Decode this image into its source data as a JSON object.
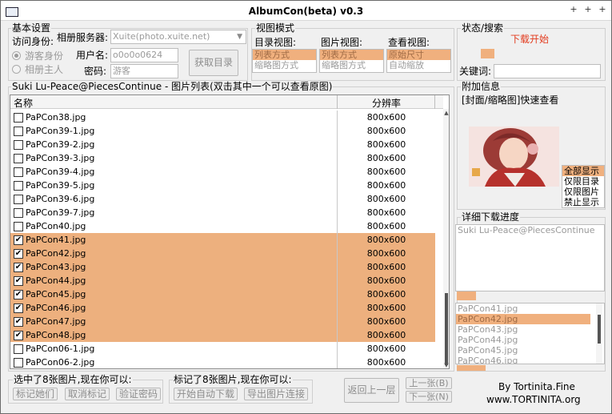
{
  "window": {
    "title": "AlbumCon(beta) v0.3",
    "controls": [
      "+",
      "+",
      "+"
    ]
  },
  "basic": {
    "group_title": "基本设置",
    "access_label": "访问身份:",
    "visitor": "游客身份",
    "owner": "相册主人",
    "server_label": "相册服务器:",
    "server_value": "Xuite(photo.xuite.net)",
    "user_label": "用户名:",
    "user_value": "o0o0o0624",
    "pass_label": "密码:",
    "pass_value": "游客",
    "fetch_button": "获取目录"
  },
  "view": {
    "group_title": "视图模式",
    "dir_view": "目录视图:",
    "pic_view": "图片视图:",
    "browse_view": "查看视图:",
    "dir_options": [
      "列表方式",
      "缩略图方式"
    ],
    "pic_options": [
      "列表方式",
      "缩略图方式"
    ],
    "browse_options": [
      "原始尺寸",
      "自动缩放"
    ],
    "dir_selected": 0,
    "pic_selected": 0,
    "browse_selected": 0
  },
  "status": {
    "group_title": "状态/搜索",
    "status_text": "下载开始",
    "keyword_label": "关键词:",
    "keyword_value": "",
    "progress": 0.14
  },
  "filelist": {
    "group_title": "Suki Lu-Peace@PiecesContinue - 图片列表(双击其中一个可以查看原图)",
    "col_name": "名称",
    "col_res": "分辨率",
    "rows": [
      {
        "name": "PaPCon38.jpg",
        "res": "800x600",
        "checked": false
      },
      {
        "name": "PaPCon39-1.jpg",
        "res": "800x600",
        "checked": false
      },
      {
        "name": "PaPCon39-2.jpg",
        "res": "800x600",
        "checked": false
      },
      {
        "name": "PaPCon39-3.jpg",
        "res": "800x600",
        "checked": false
      },
      {
        "name": "PaPCon39-4.jpg",
        "res": "800x600",
        "checked": false
      },
      {
        "name": "PaPCon39-5.jpg",
        "res": "800x600",
        "checked": false
      },
      {
        "name": "PaPCon39-6.jpg",
        "res": "800x600",
        "checked": false
      },
      {
        "name": "PaPCon39-7.jpg",
        "res": "800x600",
        "checked": false
      },
      {
        "name": "PaPCon40.jpg",
        "res": "800x600",
        "checked": false
      },
      {
        "name": "PaPCon41.jpg",
        "res": "800x600",
        "checked": true
      },
      {
        "name": "PaPCon42.jpg",
        "res": "800x600",
        "checked": true
      },
      {
        "name": "PaPCon43.jpg",
        "res": "800x600",
        "checked": true
      },
      {
        "name": "PaPCon44.jpg",
        "res": "800x600",
        "checked": true
      },
      {
        "name": "PaPCon45.jpg",
        "res": "800x600",
        "checked": true
      },
      {
        "name": "PaPCon46.jpg",
        "res": "800x600",
        "checked": true
      },
      {
        "name": "PaPCon47.jpg",
        "res": "800x600",
        "checked": true
      },
      {
        "name": "PaPCon48.jpg",
        "res": "800x600",
        "checked": true
      },
      {
        "name": "PaPCon06-1.jpg",
        "res": "800x600",
        "checked": false
      },
      {
        "name": "PaPCon06-2.jpg",
        "res": "800x600",
        "checked": false
      }
    ]
  },
  "extra": {
    "group_title": "附加信息",
    "cover_title": "[封面/缩略图]快速查看",
    "filter_options": [
      "全部显示",
      "仅限目录",
      "仅限图片",
      "禁止显示"
    ],
    "filter_selected": 0
  },
  "detail": {
    "group_title": "详细下载进度",
    "album_text": "Suki Lu-Peace@PiecesContinue",
    "progress": 0.17,
    "queue": [
      "PaPCon41.jpg",
      "PaPCon42.jpg",
      "PaPCon43.jpg",
      "PaPCon44.jpg",
      "PaPCon45.jpg",
      "PaPCon46.jpg"
    ],
    "queue_selected": 1
  },
  "selected_actions": {
    "title": "选中了8张图片,现在你可以:",
    "mark": "标记她们",
    "unmark": "取消标记",
    "verify": "验证密码"
  },
  "marked_actions": {
    "title": "标记了8张图片,现在你可以:",
    "start": "开始自动下载",
    "export": "导出图片连接"
  },
  "nav": {
    "back": "返回上一层",
    "prev": "上一张(B)",
    "next": "下一张(N)"
  },
  "credit": {
    "by": "By Tortinita.Fine",
    "site": "www.TORTINITA.org"
  },
  "colors": {
    "accent": "#edb07e",
    "status_red": "#e33b1e"
  }
}
